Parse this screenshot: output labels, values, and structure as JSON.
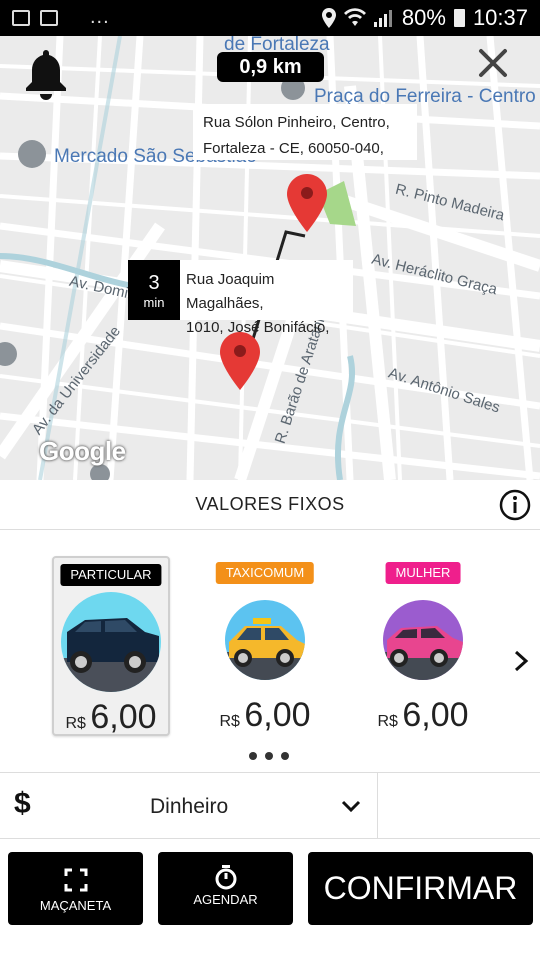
{
  "status_bar": {
    "dots": "...",
    "battery": "80%",
    "time": "10:37"
  },
  "map": {
    "distance": "0,9 km",
    "labels": {
      "fortaleza": "de Fortaleza",
      "praca": "Praça do Ferreira - Centro",
      "mercado": "Mercado São Sebastião",
      "pinto_madeira": "R. Pinto Madeira",
      "heraclito": "Av. Heráclito Graça",
      "domingos": "Av. Domingos Olímpio",
      "universidade": "Av. da Universidade",
      "barao": "R. Barão de Aratanha",
      "antonio_sales": "Av. Antônio Sales"
    },
    "destination": {
      "line1": "Rua Sólon Pinheiro, Centro,",
      "line2": "Fortaleza - CE, 60050-040,"
    },
    "origin": {
      "eta_value": "3",
      "eta_unit": "min",
      "line1": "Rua Joaquim Magalhães,",
      "line2": "1010, José Bonifácio,"
    },
    "attribution": "Google"
  },
  "fixed_values": {
    "title": "VALORES FIXOS"
  },
  "vehicles": [
    {
      "tag": "PARTICULAR",
      "tag_color": "#000000",
      "currency": "R$",
      "price": "6,00",
      "selected": true
    },
    {
      "tag": "TAXICOMUM",
      "tag_color": "#f39019",
      "currency": "R$",
      "price": "6,00",
      "selected": false
    },
    {
      "tag": "MULHER",
      "tag_color": "#ef1f8c",
      "currency": "R$",
      "price": "6,00",
      "selected": false
    }
  ],
  "payment": {
    "icon": "$",
    "method": "Dinheiro"
  },
  "buttons": {
    "macaneta": "MAÇANETA",
    "agendar": "AGENDAR",
    "confirmar": "CONFIRMAR"
  }
}
